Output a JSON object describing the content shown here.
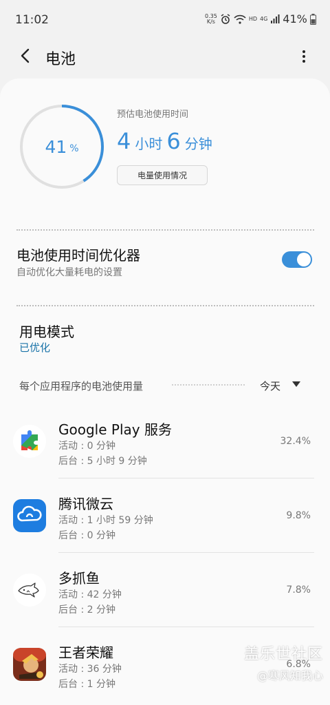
{
  "status_bar": {
    "time": "11:02",
    "net_speed_value": "0.35",
    "net_speed_unit": "K/s",
    "hd_label": "HD",
    "signal_label": "4G",
    "battery_percent": "41%"
  },
  "app_bar": {
    "title": "电池"
  },
  "battery": {
    "percent_number": "41",
    "percent_symbol": "%",
    "level_fraction": 0.41,
    "estimate_label": "预估电池使用时间",
    "estimate_hours": "4",
    "hours_unit": "小时",
    "estimate_minutes": "6",
    "minutes_unit": "分钟",
    "usage_button_label": "电量使用情况"
  },
  "optimizer": {
    "title": "电池使用时间优化器",
    "subtitle": "自动优化大量耗电的设置",
    "enabled": true
  },
  "power_mode": {
    "title": "用电模式",
    "value": "已优化"
  },
  "app_usage": {
    "section_title": "每个应用程序的电池使用量",
    "period": "今天",
    "apps": [
      {
        "name": "Google Play 服务",
        "active": "活动 : 0 分钟",
        "background": "后台 : 5 小时 9 分钟",
        "percent": "32.4%",
        "icon": "google-play-services-icon"
      },
      {
        "name": "腾讯微云",
        "active": "活动 : 1 小时 59 分钟",
        "background": "后台 : 0 分钟",
        "percent": "9.8%",
        "icon": "weiyun-icon"
      },
      {
        "name": "多抓鱼",
        "active": "活动 : 42 分钟",
        "background": "后台 : 2 分钟",
        "percent": "7.8%",
        "icon": "duozhuayu-icon"
      },
      {
        "name": "王者荣耀",
        "active": "活动 : 36 分钟",
        "background": "后台 : 1 分钟",
        "percent": "6.8%",
        "icon": "honor-of-kings-icon"
      }
    ]
  },
  "watermark": {
    "line1": "盖乐世社区",
    "line2": "@寒风知我心"
  },
  "colors": {
    "accent": "#3a8fd9",
    "mode_value": "#1a73a8",
    "background": "#f2f2f2",
    "card": "#fafafa"
  }
}
